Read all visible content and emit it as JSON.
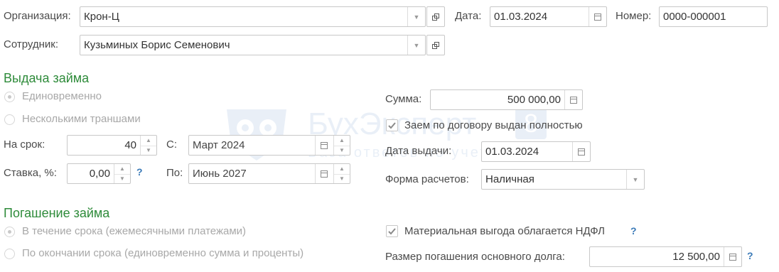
{
  "header": {
    "org_label": "Организация:",
    "org_value": "Крон-Ц",
    "date_label": "Дата:",
    "date_value": "01.03.2024",
    "number_label": "Номер:",
    "number_value": "0000-000001",
    "employee_label": "Сотрудник:",
    "employee_value": "Кузьминых Борис Семенович"
  },
  "loan_issue": {
    "title": "Выдача займа",
    "radio_once": "Единовременно",
    "radio_tranches": "Несколькими траншами",
    "term_label": "На срок:",
    "term_value": "40",
    "from_label": "С:",
    "from_value": "Март 2024",
    "rate_label": "Ставка, %:",
    "rate_value": "0,00",
    "to_label": "По:",
    "to_value": "Июнь 2027",
    "sum_label": "Сумма:",
    "sum_value": "500 000,00",
    "fully_issued_label": "Заем по договору выдан полностью",
    "issue_date_label": "Дата выдачи:",
    "issue_date_value": "01.03.2024",
    "payment_form_label": "Форма расчетов:",
    "payment_form_value": "Наличная"
  },
  "repayment": {
    "title": "Погашение займа",
    "radio_monthly": "В течение срока (ежемесячными платежами)",
    "radio_end": "По окончании срока (единовременно сумма и проценты)",
    "ndfl_label": "Материальная выгода облагается НДФЛ",
    "principal_label": "Размер погашения основного долга:",
    "principal_value": "12 500,00"
  },
  "help_glyph": "?",
  "watermark": {
    "brand": "БухЭксперт",
    "digit": "8",
    "tagline": "База ответов по учету в 1С"
  },
  "colors": {
    "section_green": "#2e8b3a",
    "help_blue": "#3a7ab8",
    "watermark_blue": "#5b8ec9"
  }
}
